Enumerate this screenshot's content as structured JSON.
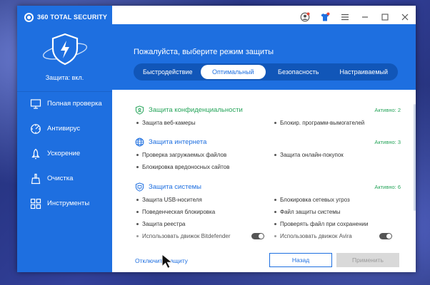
{
  "app": {
    "brand": "360 TOTAL SECURITY",
    "protection_status": "Защита: вкл."
  },
  "sidebar": {
    "items": [
      {
        "label": "Полная проверка",
        "icon": "monitor-icon"
      },
      {
        "label": "Антивирус",
        "icon": "radar-icon"
      },
      {
        "label": "Ускорение",
        "icon": "rocket-icon"
      },
      {
        "label": "Очистка",
        "icon": "broom-icon"
      },
      {
        "label": "Инструменты",
        "icon": "grid-icon"
      }
    ]
  },
  "header": {
    "title": "Пожалуйста, выберите режим защиты",
    "modes": [
      "Быстродействие",
      "Оптимальный",
      "Безопасность",
      "Настраиваемый"
    ],
    "active_mode": "Оптимальный"
  },
  "sections": {
    "privacy": {
      "title": "Защита конфиденциальности",
      "count": "Активно: 2",
      "color": "#27a55b",
      "items": [
        "Защита веб-камеры",
        "Блокир. программ-вымогателей"
      ]
    },
    "internet": {
      "title": "Защита интернета",
      "count": "Активно: 3",
      "color": "#1e6fe0",
      "items": [
        "Проверка загружаемых файлов",
        "Защита онлайн-покупок",
        "Блокировка вредоносных сайтов"
      ]
    },
    "system": {
      "title": "Защита системы",
      "count": "Активно: 6",
      "color": "#1e6fe0",
      "items": [
        "Защита USB-носителя",
        "Блокировка сетевых угроз",
        "Поведенческая блокировка",
        "Файл защиты системы",
        "Защита реестра",
        "Проверять файл при сохранении"
      ],
      "engine_bitdefender": "Использовать движок Bitdefender",
      "engine_avira": "Использовать движок Avira"
    }
  },
  "footer": {
    "disable_link": "Отключить защиту",
    "back_button": "Назад",
    "apply_button": "Применить"
  }
}
